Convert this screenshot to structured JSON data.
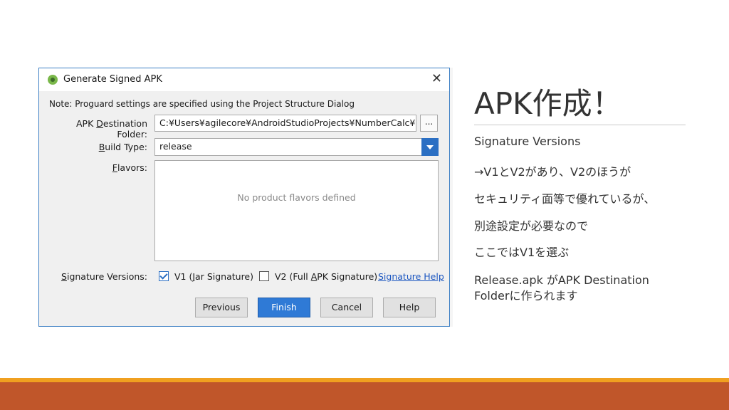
{
  "slide": {
    "title": "APK作成！",
    "lines": [
      "Signature Versions",
      "→V1とV2があり、V2のほうが",
      "セキュリティ面等で優れているが、",
      "別途設定が必要なので",
      "ここではV1を選ぶ",
      "Release.apk がAPK Destination",
      "Folderに作られます"
    ]
  },
  "dialog": {
    "title": "Generate Signed APK",
    "close_glyph": "✕",
    "note": "Note: Proguard settings are specified using the Project Structure Dialog",
    "apk_destination": {
      "label_pre": "APK ",
      "label_u": "D",
      "label_post": "estination Folder:",
      "value": "C:¥Users¥agilecore¥AndroidStudioProjects¥NumberCalc¥app",
      "browse_label": "..."
    },
    "build_type": {
      "label_u": "B",
      "label_post": "uild Type:",
      "value": "release"
    },
    "flavors": {
      "label_u": "F",
      "label_post": "lavors:",
      "empty_text": "No product flavors defined"
    },
    "signature_versions": {
      "label_u": "S",
      "label_post": "ignature Versions:",
      "v1": {
        "checked": true,
        "label_pre": "V1 (",
        "label_u": "J",
        "label_post": "ar Signature)"
      },
      "v2": {
        "checked": false,
        "label_pre": "V2 (Full ",
        "label_u": "A",
        "label_post": "PK Signature)"
      },
      "help_link": "Signature Help"
    },
    "buttons": {
      "previous": "Previous",
      "finish": "Finish",
      "cancel": "Cancel",
      "help": "Help"
    }
  },
  "colors": {
    "accent": "#2f7ad6",
    "footer_orange": "#f0a020",
    "footer_rust": "#c0562a"
  }
}
